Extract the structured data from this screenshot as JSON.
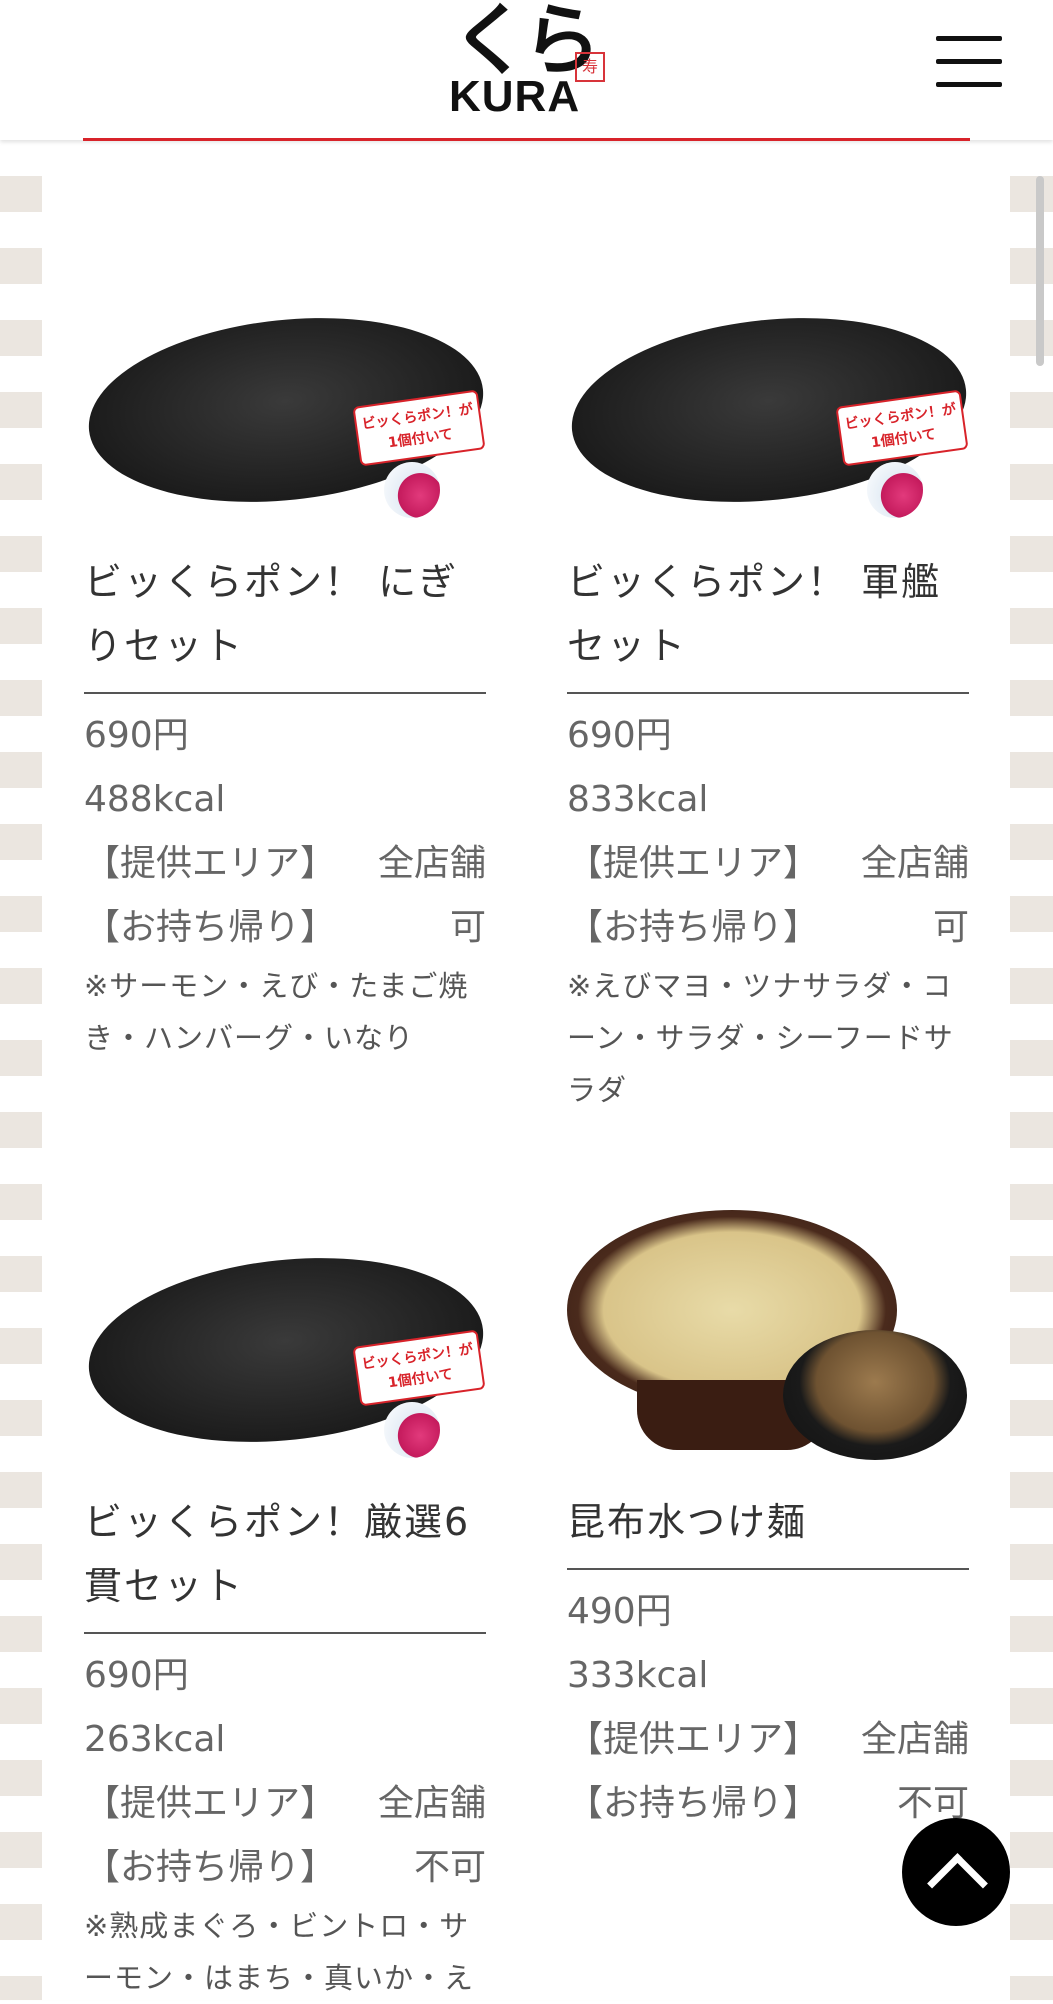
{
  "header": {
    "logo_kana": "くら",
    "logo_text": "KURA",
    "logo_stamp": "寿司",
    "menu_icon": "hamburger-menu-icon"
  },
  "items": [
    {
      "name": "ビッくらポン！ にぎりセット",
      "price": "690円",
      "kcal": "488kcal",
      "area_label": "【提供エリア】",
      "area_value": "全店舗",
      "takeout_label": "【お持ち帰り】",
      "takeout_value": "可",
      "note": "※サーモン・えび・たまご焼き・ハンバーグ・いなり",
      "badge": "ビッくらポン！が1個付いて"
    },
    {
      "name": "ビッくらポン！ 軍艦セット",
      "price": "690円",
      "kcal": "833kcal",
      "area_label": "【提供エリア】",
      "area_value": "全店舗",
      "takeout_label": "【お持ち帰り】",
      "takeout_value": "可",
      "note": "※えびマヨ・ツナサラダ・コーン・サラダ・シーフードサラダ",
      "badge": "ビッくらポン！が1個付いて"
    },
    {
      "name": "ビッくらポン！厳選6貫セット",
      "price": "690円",
      "kcal": "263kcal",
      "area_label": "【提供エリア】",
      "area_value": "全店舗",
      "takeout_label": "【お持ち帰り】",
      "takeout_value": "不可",
      "note": "※熟成まぐろ・ビントロ・サーモン・はまち・真いか・え",
      "badge": "ビッくらポン！が1個付いて"
    },
    {
      "name": "昆布水つけ麺",
      "price": "490円",
      "kcal": "333kcal",
      "area_label": "【提供エリア】",
      "area_value": "全店舗",
      "takeout_label": "【お持ち帰り】",
      "takeout_value": "不可"
    }
  ],
  "back_to_top_icon": "chevron-up-icon",
  "colors": {
    "accent": "#d8232a",
    "text": "#333333",
    "subtext": "#666666"
  }
}
